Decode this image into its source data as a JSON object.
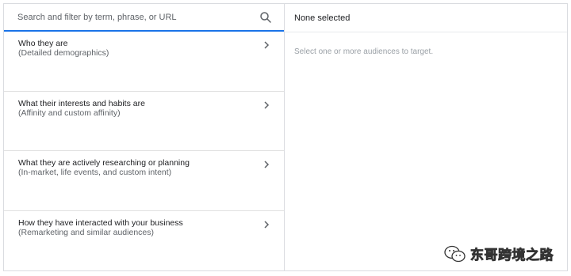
{
  "search": {
    "placeholder": "Search and filter by term, phrase, or URL",
    "value": ""
  },
  "categories": [
    {
      "title": "Who they are",
      "subtitle": "(Detailed demographics)"
    },
    {
      "title": "What their interests and habits are",
      "subtitle": "(Affinity and custom affinity)"
    },
    {
      "title": "What they are actively researching or planning",
      "subtitle": "(In-market, life events, and custom intent)"
    },
    {
      "title": "How they have interacted with your business",
      "subtitle": "(Remarketing and similar audiences)"
    }
  ],
  "selection": {
    "header": "None selected",
    "hint": "Select one or more audiences to target."
  },
  "watermark": {
    "text": "东哥跨境之路"
  },
  "colors": {
    "accent": "#1a73e8",
    "border": "#dadce0",
    "text_primary": "#202124",
    "text_secondary": "#5f6368",
    "text_hint": "#9aa0a6"
  },
  "icons": {
    "search": "search-icon",
    "chevron": "chevron-right-icon",
    "watermark": "wechat-icon"
  }
}
